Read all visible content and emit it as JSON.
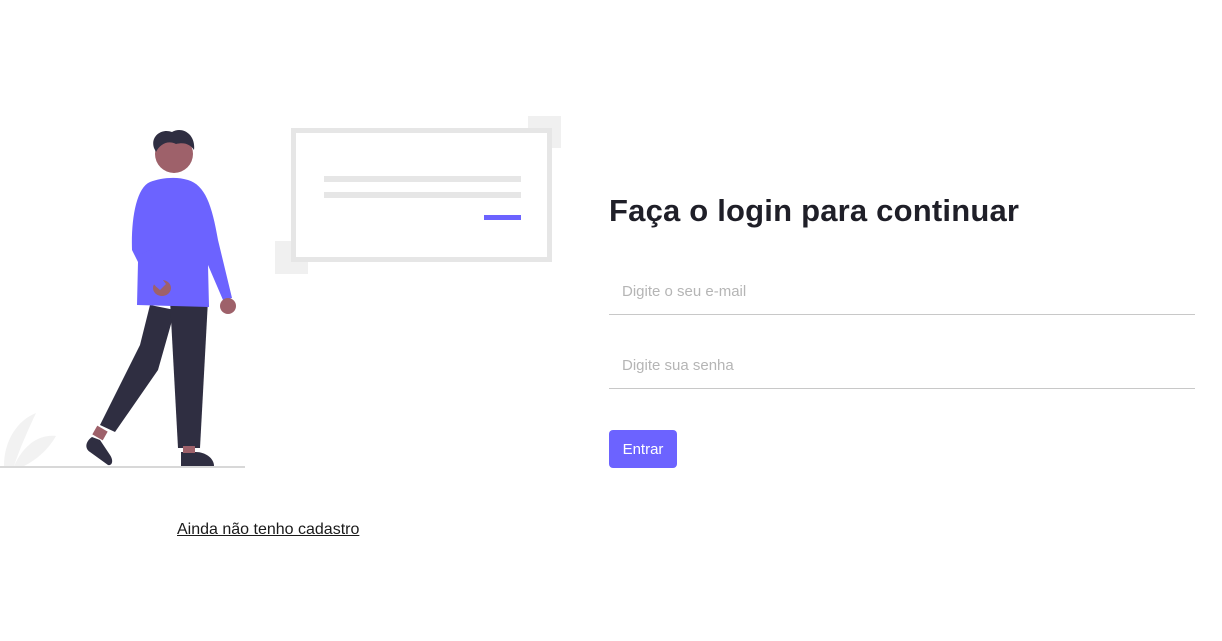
{
  "login": {
    "title": "Faça o login para continuar",
    "email_placeholder": "Digite o seu e-mail",
    "password_placeholder": "Digite sua senha",
    "submit_label": "Entrar"
  },
  "signup_link": "Ainda não tenho cadastro",
  "colors": {
    "accent": "#6c63ff",
    "text_dark": "#1f1f28",
    "figure_dark": "#2f2e41",
    "skin": "#9e616a",
    "light_gray": "#e6e6e6"
  }
}
